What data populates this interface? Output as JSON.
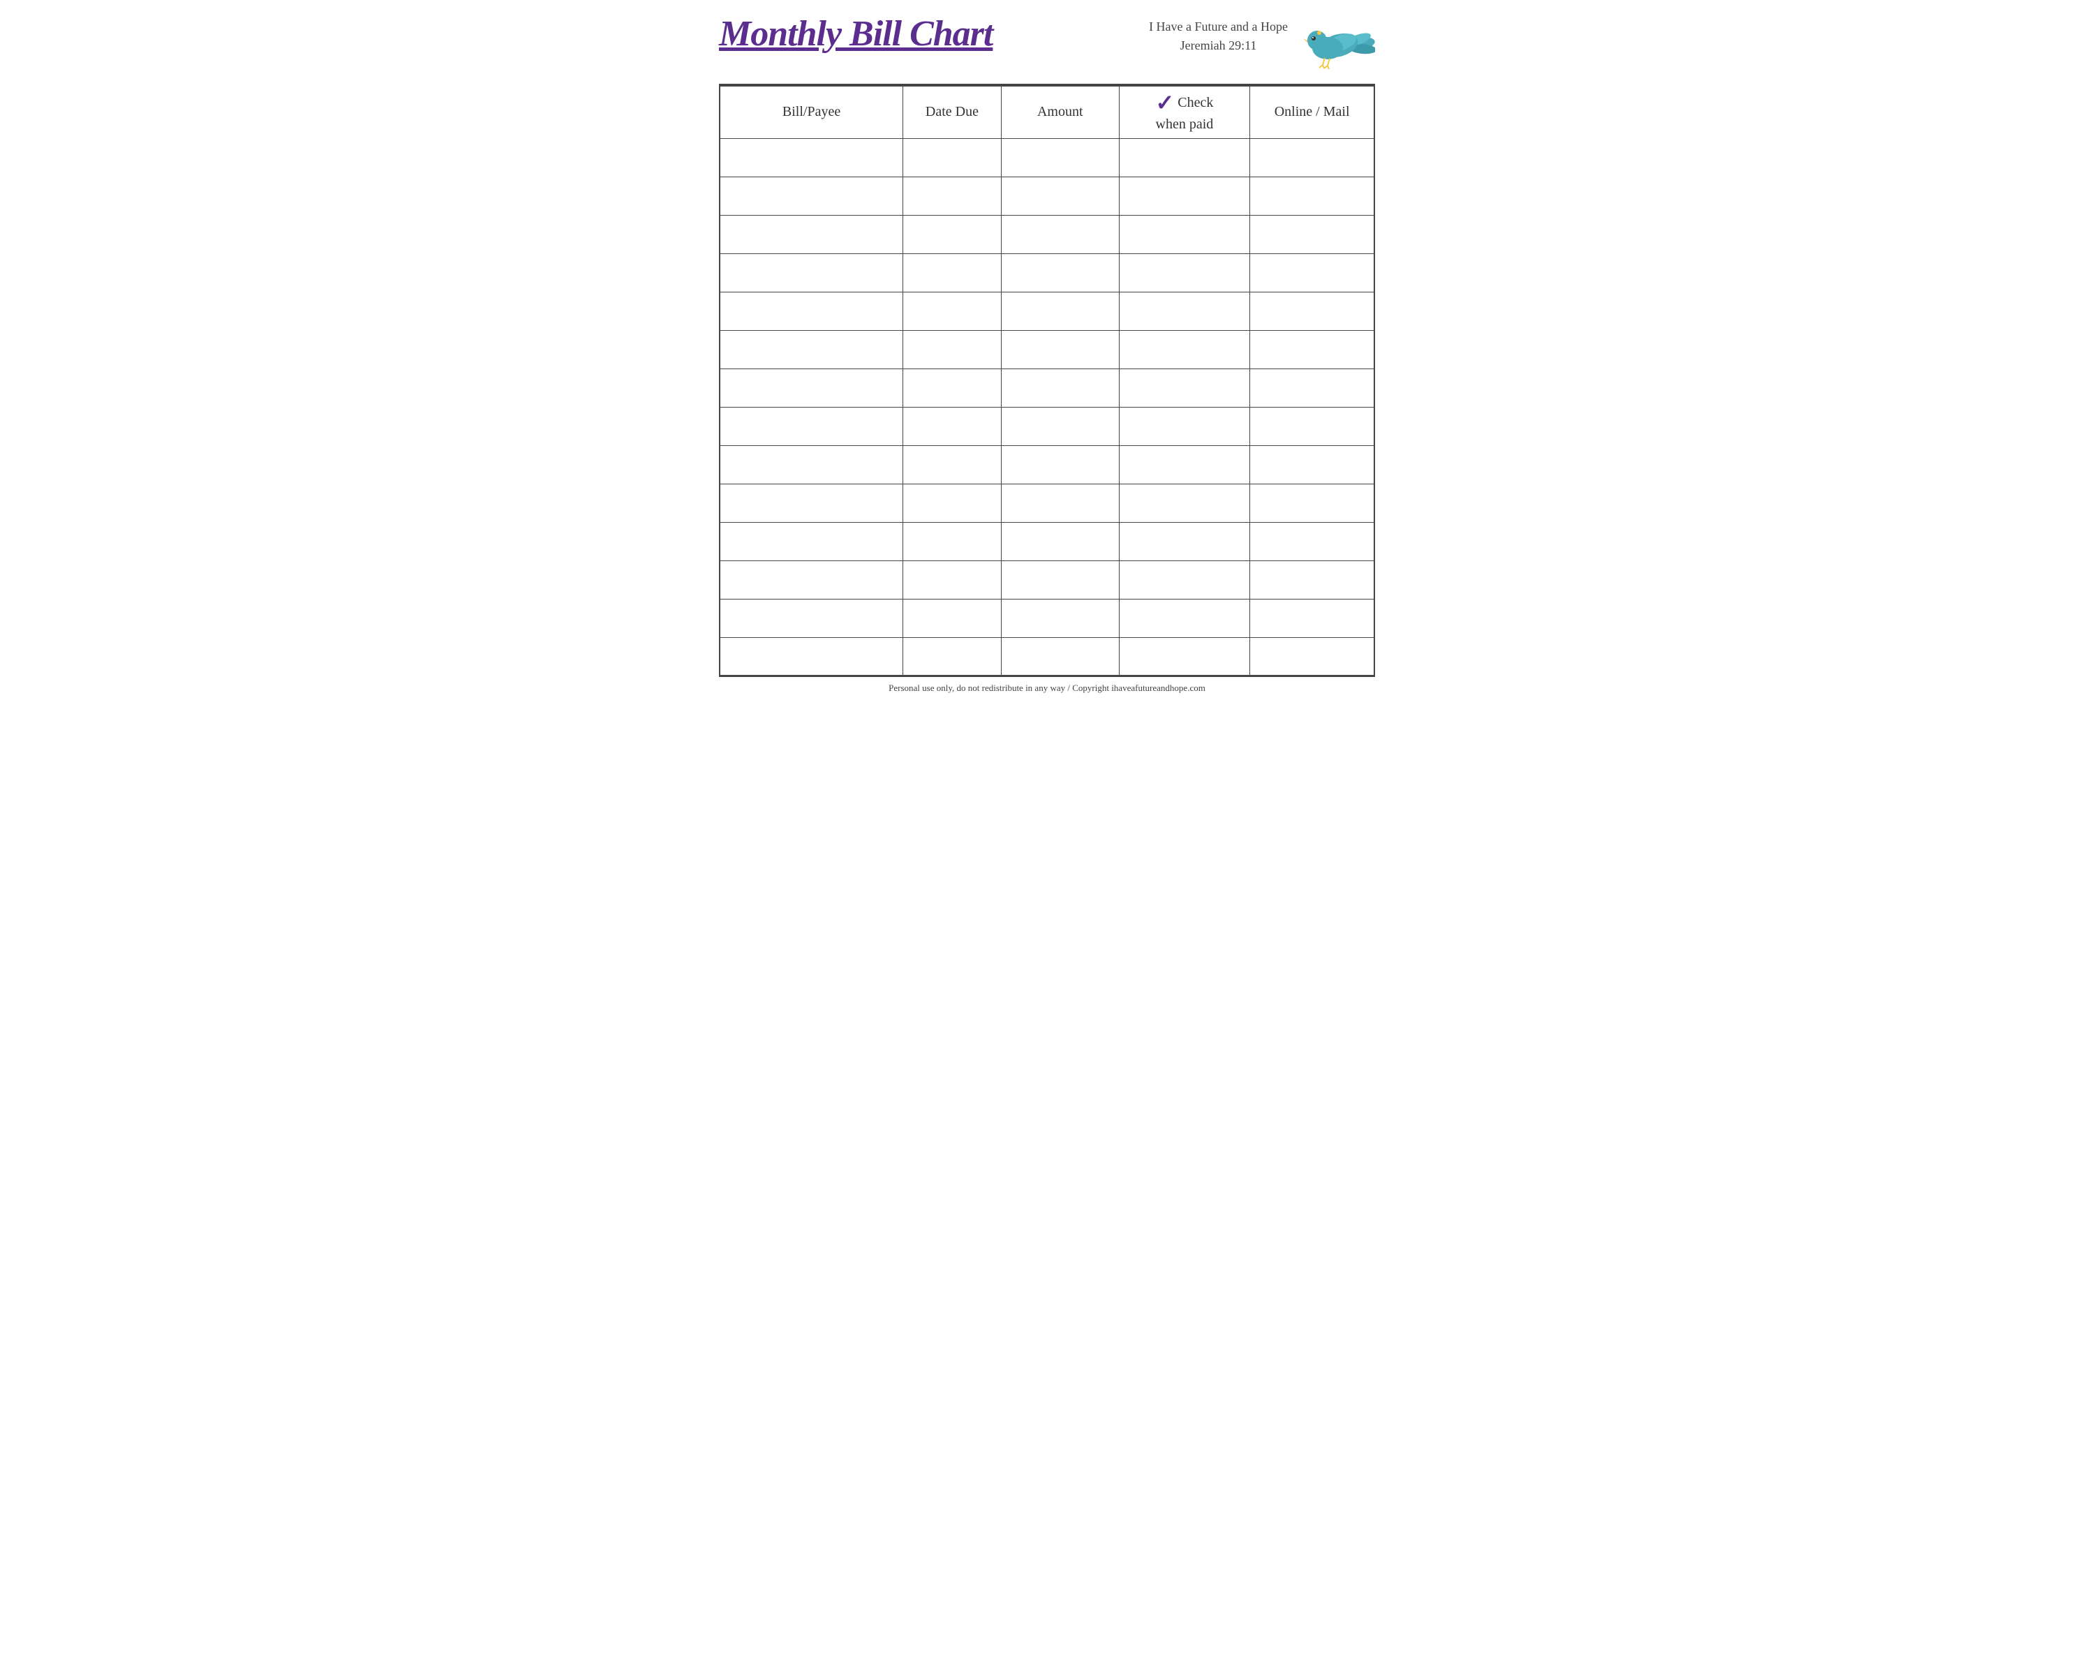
{
  "header": {
    "title": "Monthly Bill Chart",
    "scripture_line1": "I Have a Future and a Hope",
    "scripture_line2": "Jeremiah 29:11"
  },
  "table": {
    "columns": [
      {
        "id": "bill-payee",
        "label": "Bill/Payee"
      },
      {
        "id": "date-due",
        "label": "Date Due"
      },
      {
        "id": "amount",
        "label": "Amount"
      },
      {
        "id": "check-when-paid",
        "label_line1": "Check",
        "label_line2": "when paid",
        "has_checkmark": true
      },
      {
        "id": "online-mail",
        "label": "Online / Mail"
      }
    ],
    "row_count": 14
  },
  "footer": {
    "text": "Personal use only, do not redistribute in any way / Copyright ihaveafutureandhope.com"
  },
  "colors": {
    "title": "#5b2d8e",
    "checkmark": "#5b2d8e",
    "border": "#444444",
    "text": "#333333"
  }
}
